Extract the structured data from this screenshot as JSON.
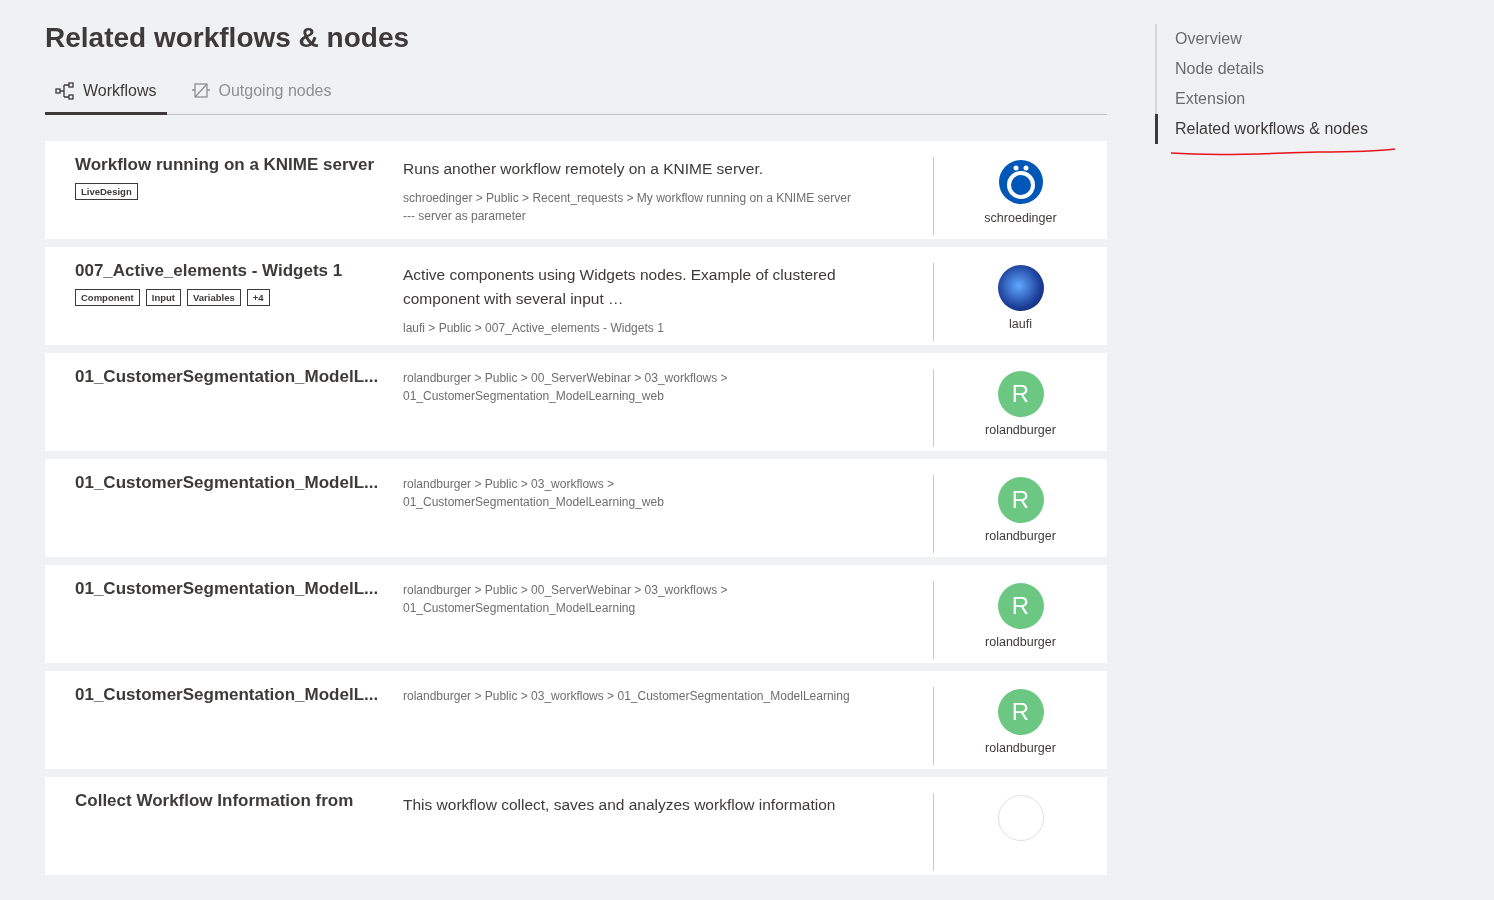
{
  "heading": "Related workflows & nodes",
  "tabs": [
    {
      "label": "Workflows",
      "kind": "workflow",
      "selected": true,
      "disabled": false
    },
    {
      "label": "Outgoing nodes",
      "kind": "node",
      "selected": false,
      "disabled": true
    }
  ],
  "cards": [
    {
      "title": "Workflow running on a KNIME server",
      "tags": [
        "LiveDesign"
      ],
      "description": "Runs another workflow remotely on a KNIME server.",
      "path": "schroedinger > Public > Recent_requests > My workflow running on a KNIME server --- server as parameter",
      "avatar": {
        "kind": "logo",
        "user": "schroedinger"
      }
    },
    {
      "title": "007_Active_elements - Widgets 1",
      "tags": [
        "Component",
        "Input",
        "Variables",
        "+4"
      ],
      "description": "Active components using Widgets nodes. Example of clustered component with several input …",
      "path": "laufi > Public > 007_Active_elements - Widgets 1",
      "avatar": {
        "kind": "photo",
        "user": "laufi"
      }
    },
    {
      "title": "01_CustomerSegmentation_ModelL...",
      "path": "rolandburger > Public > 00_ServerWebinar > 03_workflows > 01_CustomerSegmentation_ModelLearning_web",
      "avatar": {
        "kind": "letter",
        "letter": "R",
        "color": "#6cc783",
        "user": "rolandburger"
      }
    },
    {
      "title": "01_CustomerSegmentation_ModelL...",
      "path": "rolandburger > Public > 03_workflows > 01_CustomerSegmentation_ModelLearning_web",
      "avatar": {
        "kind": "letter",
        "letter": "R",
        "color": "#6cc783",
        "user": "rolandburger"
      }
    },
    {
      "title": "01_CustomerSegmentation_ModelL...",
      "path": "rolandburger > Public > 00_ServerWebinar > 03_workflows > 01_CustomerSegmentation_ModelLearning",
      "avatar": {
        "kind": "letter",
        "letter": "R",
        "color": "#6cc783",
        "user": "rolandburger"
      }
    },
    {
      "title": "01_CustomerSegmentation_ModelL...",
      "path": "rolandburger > Public > 03_workflows > 01_CustomerSegmentation_ModelLearning",
      "avatar": {
        "kind": "letter",
        "letter": "R",
        "color": "#6cc783",
        "user": "rolandburger"
      }
    },
    {
      "title": "Collect Workflow Information from",
      "description": "This workflow collect, saves and analyzes workflow information",
      "avatar": {
        "kind": "plain"
      }
    }
  ],
  "toc": [
    {
      "label": "Overview",
      "selected": false
    },
    {
      "label": "Node details",
      "selected": false
    },
    {
      "label": "Extension",
      "selected": false
    },
    {
      "label": "Related workflows & nodes",
      "selected": true
    }
  ]
}
